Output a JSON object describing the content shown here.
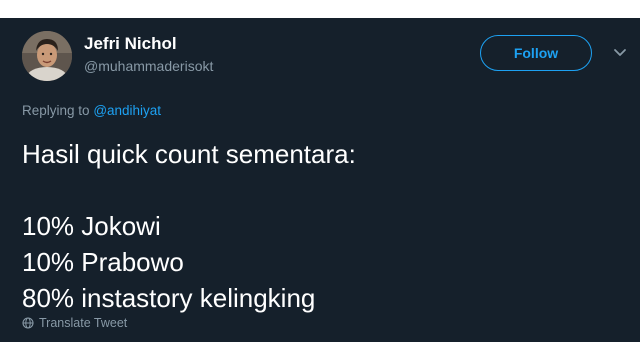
{
  "tweet": {
    "display_name": "Jefri Nichol",
    "handle": "@muhammaderisokt",
    "follow_label": "Follow",
    "replying_prefix": "Replying to",
    "replying_mention": "@andihiyat",
    "body_lines": [
      "Hasil quick count sementara:",
      "",
      "10% Jokowi",
      "10% Prabowo",
      "80% instastory kelingking"
    ],
    "translate_label": "Translate Tweet"
  },
  "icons": {
    "avatar": "avatar-photo",
    "more": "chevron-down-icon",
    "translate": "globe-icon"
  },
  "colors": {
    "background": "#15202b",
    "accent": "#1da1f2",
    "secondary_text": "#8899a6",
    "primary_text": "#ffffff"
  }
}
